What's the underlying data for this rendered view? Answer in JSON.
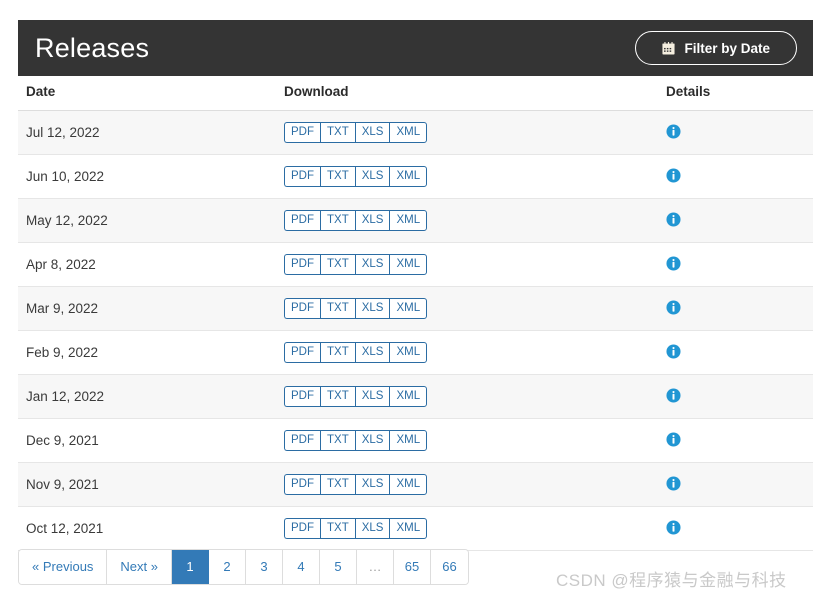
{
  "header": {
    "title": "Releases",
    "filter_button": {
      "label": "Filter by Date",
      "icon": "calendar-icon"
    }
  },
  "table": {
    "columns": [
      "Date",
      "Download",
      "Details"
    ],
    "download_formats": [
      "PDF",
      "TXT",
      "XLS",
      "XML"
    ],
    "details_icon": "info-circle-icon",
    "rows": [
      {
        "date": "Jul 12, 2022"
      },
      {
        "date": "Jun 10, 2022"
      },
      {
        "date": "May 12, 2022"
      },
      {
        "date": "Apr 8, 2022"
      },
      {
        "date": "Mar 9, 2022"
      },
      {
        "date": "Feb 9, 2022"
      },
      {
        "date": "Jan 12, 2022"
      },
      {
        "date": "Dec 9, 2021"
      },
      {
        "date": "Nov 9, 2021"
      },
      {
        "date": "Oct 12, 2021"
      }
    ]
  },
  "pagination": {
    "items": [
      {
        "label": "« Previous",
        "name": "previous",
        "state": "normal"
      },
      {
        "label": "Next »",
        "name": "next",
        "state": "normal"
      },
      {
        "label": "1",
        "name": "page-1",
        "state": "active"
      },
      {
        "label": "2",
        "name": "page-2",
        "state": "normal"
      },
      {
        "label": "3",
        "name": "page-3",
        "state": "normal"
      },
      {
        "label": "4",
        "name": "page-4",
        "state": "normal"
      },
      {
        "label": "5",
        "name": "page-5",
        "state": "normal"
      },
      {
        "label": "…",
        "name": "ellipsis",
        "state": "disabled"
      },
      {
        "label": "65",
        "name": "page-65",
        "state": "normal"
      },
      {
        "label": "66",
        "name": "page-66",
        "state": "normal"
      }
    ]
  },
  "watermark": {
    "text": "CSDN @程序猿与金融与科技"
  },
  "colors": {
    "header_bar": "#343434",
    "link_blue": "#337ab7",
    "button_blue": "#2b6ca3",
    "info_icon": "#2196d3",
    "row_stripe": "#f7f7f7"
  }
}
